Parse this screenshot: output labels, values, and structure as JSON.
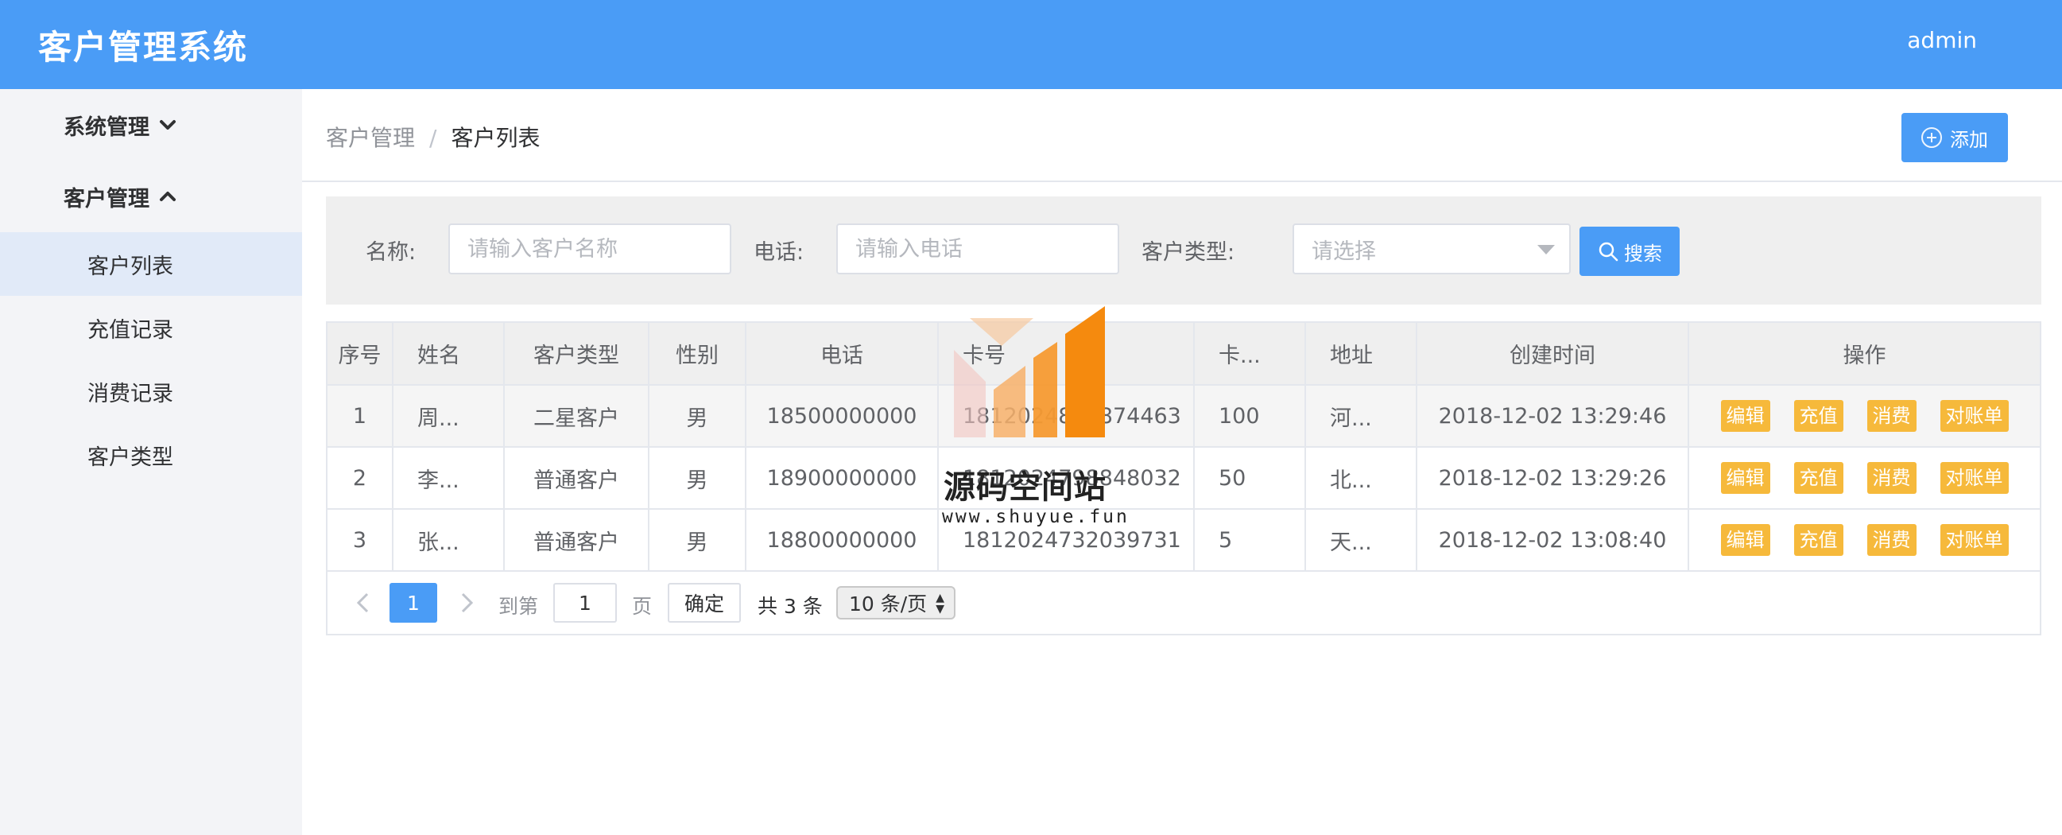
{
  "header": {
    "app_title": "客户管理系统",
    "user": "admin"
  },
  "sidebar": {
    "groups": [
      {
        "label": "系统管理",
        "expanded": false
      },
      {
        "label": "客户管理",
        "expanded": true
      }
    ],
    "items": [
      {
        "label": "客户列表",
        "active": true
      },
      {
        "label": "充值记录",
        "active": false
      },
      {
        "label": "消费记录",
        "active": false
      },
      {
        "label": "客户类型",
        "active": false
      }
    ]
  },
  "breadcrumb": {
    "parent": "客户管理",
    "separator": "/",
    "current": "客户列表"
  },
  "toolbar": {
    "add_label": "添加"
  },
  "search": {
    "name_label": "名称:",
    "name_placeholder": "请输入客户名称",
    "phone_label": "电话:",
    "phone_placeholder": "请输入电话",
    "type_label": "客户类型:",
    "type_placeholder": "请选择",
    "search_label": "搜索"
  },
  "table": {
    "columns": [
      "序号",
      "姓名",
      "客户类型",
      "性别",
      "电话",
      "卡号",
      "卡...",
      "地址",
      "创建时间",
      "操作"
    ],
    "rows": [
      {
        "index": "1",
        "name": "周...",
        "type": "二星客户",
        "gender": "男",
        "phone": "18500000000",
        "card": "1812024813874463",
        "balance": "100",
        "address": "河...",
        "created": "2018-12-02 13:29:46"
      },
      {
        "index": "2",
        "name": "李...",
        "type": "普通客户",
        "gender": "男",
        "phone": "18900000000",
        "card": "1812024798848032",
        "balance": "50",
        "address": "北...",
        "created": "2018-12-02 13:29:26"
      },
      {
        "index": "3",
        "name": "张...",
        "type": "普通客户",
        "gender": "男",
        "phone": "18800000000",
        "card": "1812024732039731",
        "balance": "5",
        "address": "天...",
        "created": "2018-12-02 13:08:40"
      }
    ],
    "ops": {
      "edit": "编辑",
      "recharge": "充值",
      "consume": "消费",
      "statement": "对账单"
    }
  },
  "pagination": {
    "current": "1",
    "goto_label": "到第",
    "goto_value": "1",
    "page_unit": "页",
    "confirm": "确定",
    "total": "共 3 条",
    "page_size": "10 条/页"
  },
  "watermark": {
    "title": "源码空间站",
    "url": "www.shuyue.fun"
  },
  "colors": {
    "primary": "#4a9cf6",
    "warning": "#f6b93b",
    "sidebar_bg": "#f3f4f7",
    "active_item": "#e1eaf8"
  }
}
